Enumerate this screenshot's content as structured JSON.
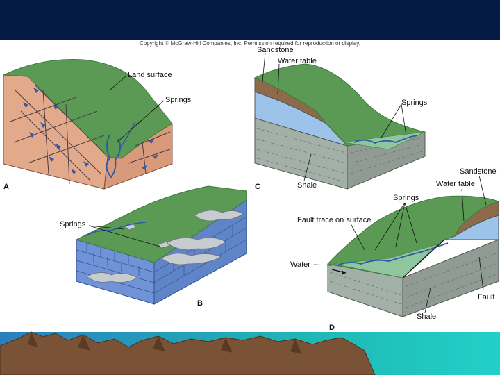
{
  "copyright": "Copyright © McGraw-Hill Companies, Inc. Permission required for reproduction or display.",
  "panels": {
    "a": {
      "letter": "A",
      "labels": {
        "land_surface": "Land surface",
        "springs": "Springs"
      }
    },
    "b": {
      "letter": "B",
      "labels": {
        "springs": "Springs"
      }
    },
    "c": {
      "letter": "C",
      "labels": {
        "sandstone": "Sandstone",
        "water_table": "Water table",
        "springs": "Springs",
        "shale": "Shale"
      }
    },
    "d": {
      "letter": "D",
      "labels": {
        "sandstone": "Sandstone",
        "water_table": "Water table",
        "springs": "Springs",
        "fault_trace": "Fault trace on surface",
        "water": "Water",
        "fault": "Fault",
        "shale": "Shale"
      }
    }
  },
  "colors": {
    "header_band": "#051a44",
    "grass": "#5a9a55",
    "grass_dark": "#3f7a3e",
    "rock_pink": "#e2a98a",
    "limestone": "#6f93d6",
    "shale": "#a3b0a7",
    "sandstone_blue": "#9cc4ea",
    "sandstone_brown": "#8c6a4a",
    "water": "#2d5aa8",
    "mountains": "#7a5236",
    "sky_teal": "#1fb6b4"
  }
}
